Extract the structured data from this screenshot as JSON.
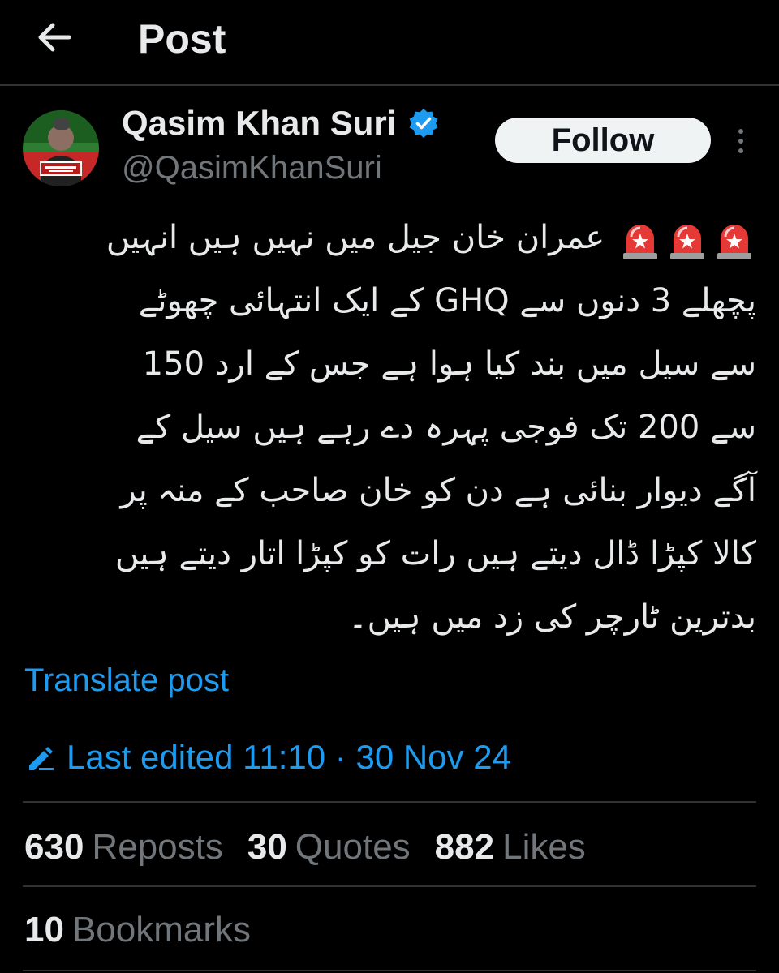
{
  "header": {
    "title": "Post",
    "back_icon": "arrow-left-icon"
  },
  "author": {
    "display_name": "Qasim Khan Suri",
    "handle": "@QasimKhanSuri",
    "verified": true,
    "verified_icon": "verified-badge-icon",
    "avatar_icon": "profile-avatar-icon"
  },
  "actions": {
    "follow_label": "Follow",
    "more_icon": "more-vertical-icon"
  },
  "post": {
    "emoji": "🚨🚨🚨",
    "emoji_icon": "police-siren-icon",
    "lines": [
      "عمران خان جیل میں نہیں ہیں انہیں",
      "پچھلے 3 دنوں سے GHQ کے ایک انتہائی چھوٹے",
      "سے سیل میں بند کیا ہوا ہے جس کے ارد 150",
      "سے 200 تک فوجی پہرہ دے رہے ہیں سیل کے",
      "آگے دیوار بنائی ہے دن کو خان صاحب کے منہ پر",
      "کالا کپڑا ڈال دیتے ہیں رات کو کپڑا اتار دیتے ہیں",
      "بدترین ٹارچر کی زد میں ہیں۔"
    ],
    "translate_label": "Translate post",
    "edited_label": "Last edited 11:10 · 30 Nov 24",
    "edited_icon": "edit-pencil-icon"
  },
  "stats": {
    "reposts_count": "630",
    "reposts_label": "Reposts",
    "quotes_count": "30",
    "quotes_label": "Quotes",
    "likes_count": "882",
    "likes_label": "Likes",
    "bookmarks_count": "10",
    "bookmarks_label": "Bookmarks"
  },
  "colors": {
    "background": "#000000",
    "text": "#e7e9ea",
    "muted": "#71767b",
    "accent": "#1d9bf0",
    "divider": "#2f3336"
  }
}
